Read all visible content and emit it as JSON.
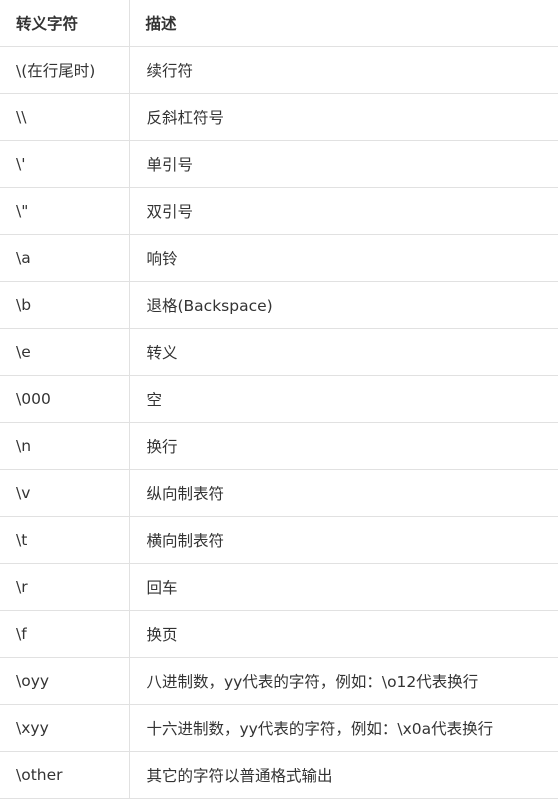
{
  "table": {
    "headers": [
      "转义字符",
      "描述"
    ],
    "rows": [
      {
        "escape": "\\(在行尾时)",
        "description": "续行符"
      },
      {
        "escape": "\\\\",
        "description": "反斜杠符号"
      },
      {
        "escape": "\\'",
        "description": "单引号"
      },
      {
        "escape": "\\\"",
        "description": "双引号"
      },
      {
        "escape": "\\a",
        "description": "响铃"
      },
      {
        "escape": "\\b",
        "description": "退格(Backspace)"
      },
      {
        "escape": "\\e",
        "description": "转义"
      },
      {
        "escape": "\\000",
        "description": "空"
      },
      {
        "escape": "\\n",
        "description": "换行"
      },
      {
        "escape": "\\v",
        "description": "纵向制表符"
      },
      {
        "escape": "\\t",
        "description": "横向制表符"
      },
      {
        "escape": "\\r",
        "description": "回车"
      },
      {
        "escape": "\\f",
        "description": "换页"
      },
      {
        "escape": "\\oyy",
        "description": "八进制数，yy代表的字符，例如：\\o12代表换行"
      },
      {
        "escape": "\\xyy",
        "description": "十六进制数，yy代表的字符，例如：\\x0a代表换行"
      },
      {
        "escape": "\\other",
        "description": "其它的字符以普通格式输出"
      }
    ]
  }
}
